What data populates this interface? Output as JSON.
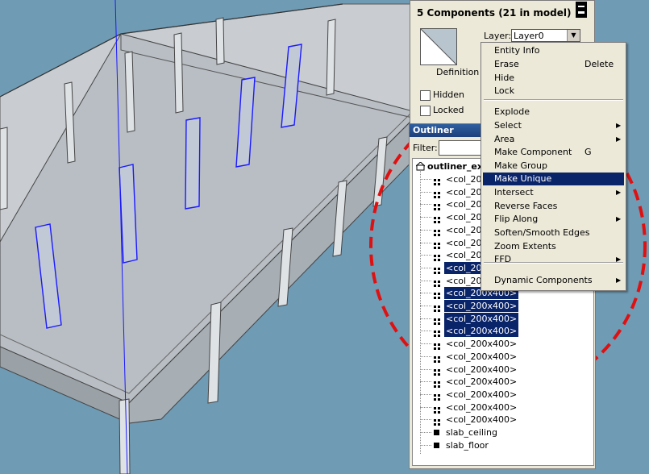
{
  "colors": {
    "background": "#6f9bb4",
    "selection": "#0a246a",
    "selected_edge": "#1a1aff",
    "annotation": "#e01010"
  },
  "entity_info": {
    "title": "5 Components (21 in model)",
    "layer_label": "Layer:",
    "layer_value": "Layer0",
    "definition_label": "Definition",
    "hidden_label": "Hidden",
    "locked_label": "Locked"
  },
  "outliner": {
    "title": "Outliner",
    "filter_label": "Filter:",
    "root": "outliner_ex",
    "items": [
      {
        "label": "<col_200x400>",
        "selected": false
      },
      {
        "label": "<col_200x400>",
        "selected": false
      },
      {
        "label": "<col_200x400>",
        "selected": false
      },
      {
        "label": "<col_200x400>",
        "selected": false
      },
      {
        "label": "<col_200x400>",
        "selected": false
      },
      {
        "label": "<col_200x400>",
        "selected": false
      },
      {
        "label": "<col_200x400>",
        "selected": false
      },
      {
        "label": "<col_200x400>",
        "selected": true
      },
      {
        "label": "<col_200x400>",
        "selected": false
      },
      {
        "label": "<col_200x400>",
        "selected": true
      },
      {
        "label": "<col_200x400>",
        "selected": true
      },
      {
        "label": "<col_200x400>",
        "selected": true
      },
      {
        "label": "<col_200x400>",
        "selected": true
      },
      {
        "label": "<col_200x400>",
        "selected": false
      },
      {
        "label": "<col_200x400>",
        "selected": false
      },
      {
        "label": "<col_200x400>",
        "selected": false
      },
      {
        "label": "<col_200x400>",
        "selected": false
      },
      {
        "label": "<col_200x400>",
        "selected": false
      },
      {
        "label": "<col_200x400>",
        "selected": false
      },
      {
        "label": "<col_200x400>",
        "selected": false
      },
      {
        "label": "slab_ceiling",
        "selected": false,
        "icon": "square"
      },
      {
        "label": "slab_floor",
        "selected": false,
        "icon": "square"
      }
    ]
  },
  "context_menu": {
    "items": [
      {
        "label": "Entity Info",
        "shortcut": "",
        "submenu": false
      },
      {
        "label": "Erase",
        "shortcut": "Delete",
        "submenu": false
      },
      {
        "label": "Hide",
        "shortcut": "",
        "submenu": false
      },
      {
        "label": "Lock",
        "shortcut": "",
        "submenu": false
      },
      {
        "label": "Explode",
        "shortcut": "",
        "submenu": false
      },
      {
        "label": "Select",
        "shortcut": "",
        "submenu": true
      },
      {
        "label": "Area",
        "shortcut": "",
        "submenu": true
      },
      {
        "label": "Make Component",
        "shortcut": "G",
        "submenu": false
      },
      {
        "label": "Make Group",
        "shortcut": "",
        "submenu": false
      },
      {
        "label": "Make Unique",
        "shortcut": "",
        "submenu": false,
        "highlighted": true
      },
      {
        "label": "Intersect",
        "shortcut": "",
        "submenu": true
      },
      {
        "label": "Reverse Faces",
        "shortcut": "",
        "submenu": false
      },
      {
        "label": "Flip Along",
        "shortcut": "",
        "submenu": true
      },
      {
        "label": "Soften/Smooth Edges",
        "shortcut": "",
        "submenu": false
      },
      {
        "label": "Zoom Extents",
        "shortcut": "",
        "submenu": false
      },
      {
        "label": "FFD",
        "shortcut": "",
        "submenu": true
      },
      {
        "label": "Dynamic Components",
        "shortcut": "",
        "submenu": true
      }
    ]
  }
}
